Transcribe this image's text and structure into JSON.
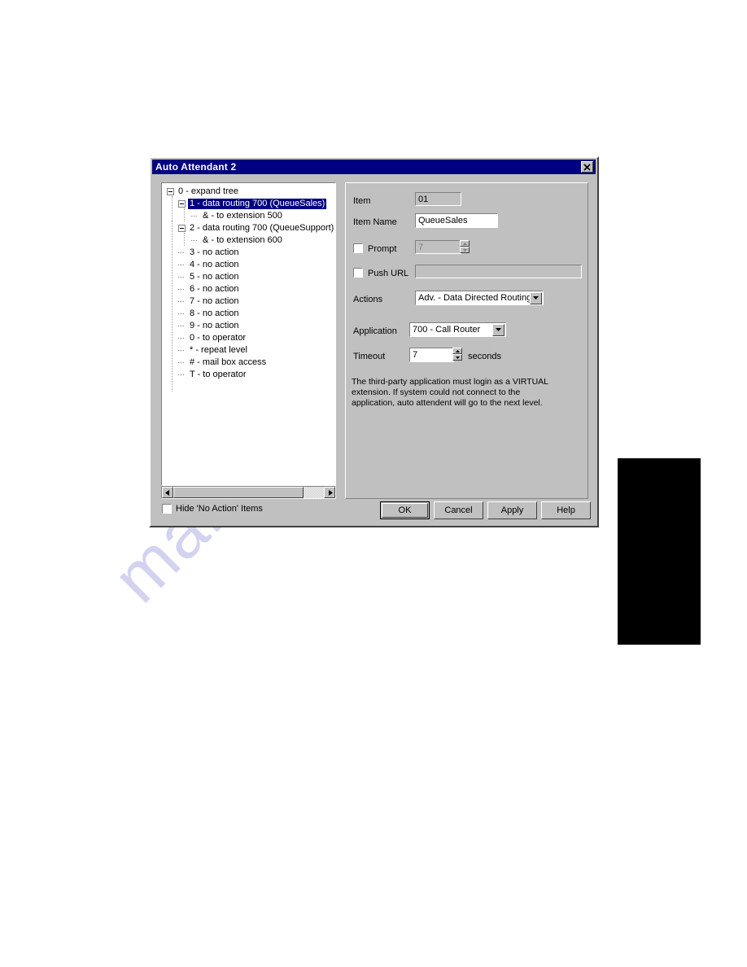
{
  "window": {
    "title": "Auto Attendant 2",
    "close_icon": "close-icon"
  },
  "tree": {
    "items": [
      {
        "label": "0 - expand tree",
        "indent": 0,
        "marker": "expander",
        "selected": false
      },
      {
        "label": "1 - data routing 700 (QueueSales)",
        "indent": 1,
        "marker": "expander",
        "selected": true
      },
      {
        "label": "& - to extension 500",
        "indent": 2,
        "marker": "dash",
        "selected": false
      },
      {
        "label": "2 - data routing 700 (QueueSupport)",
        "indent": 1,
        "marker": "expander",
        "selected": false
      },
      {
        "label": "& - to extension 600",
        "indent": 2,
        "marker": "dash",
        "selected": false
      },
      {
        "label": "3 - no action",
        "indent": 1,
        "marker": "dash",
        "selected": false
      },
      {
        "label": "4 - no action",
        "indent": 1,
        "marker": "dash",
        "selected": false
      },
      {
        "label": "5 - no action",
        "indent": 1,
        "marker": "dash",
        "selected": false
      },
      {
        "label": "6 - no action",
        "indent": 1,
        "marker": "dash",
        "selected": false
      },
      {
        "label": "7 - no action",
        "indent": 1,
        "marker": "dash",
        "selected": false
      },
      {
        "label": "8 - no action",
        "indent": 1,
        "marker": "dash",
        "selected": false
      },
      {
        "label": "9 - no action",
        "indent": 1,
        "marker": "dash",
        "selected": false
      },
      {
        "label": "0 - to operator",
        "indent": 1,
        "marker": "dash",
        "selected": false
      },
      {
        "label": "* - repeat level",
        "indent": 1,
        "marker": "dash",
        "selected": false
      },
      {
        "label": "# - mail box access",
        "indent": 1,
        "marker": "dash",
        "selected": false
      },
      {
        "label": "T - to operator",
        "indent": 1,
        "marker": "dash",
        "selected": false
      }
    ],
    "scrollbar": {
      "left_arrow": "◄",
      "right_arrow": "►"
    }
  },
  "properties": {
    "item_label": "Item",
    "item_value": "01",
    "item_name_label": "Item Name",
    "item_name_value": "QueueSales",
    "prompt_label": "Prompt",
    "prompt_value": "7",
    "prompt_checked": false,
    "push_url_label": "Push URL",
    "push_url_value": "",
    "push_url_checked": false,
    "actions_label": "Actions",
    "actions_value": "Adv. - Data Directed Routing",
    "application_label": "Application",
    "application_value": "700 - Call Router",
    "timeout_label": "Timeout",
    "timeout_value": "7",
    "timeout_units": "seconds",
    "help_text": "The third-party application must login as a VIRTUAL extension. If system could not connect to the application, auto attendent will go to the next level."
  },
  "footer": {
    "hide_no_action_label": "Hide 'No Action' Items",
    "hide_no_action_checked": false,
    "buttons": {
      "ok": "OK",
      "cancel": "Cancel",
      "apply": "Apply",
      "help": "Help"
    }
  },
  "page": {
    "watermark_text": "manualshive.com"
  }
}
